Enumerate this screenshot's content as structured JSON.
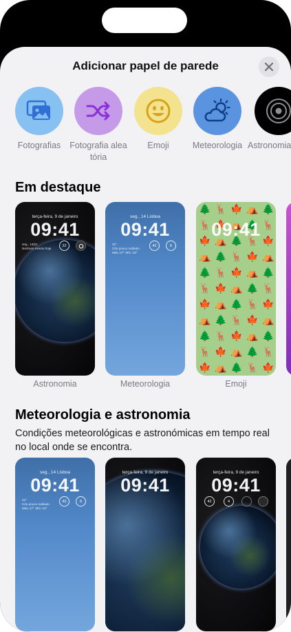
{
  "header": {
    "title": "Adicionar papel de parede"
  },
  "categories": [
    {
      "label": "Fotografias",
      "icon": "photos-icon",
      "color": "#87c1f2"
    },
    {
      "label": "Fotografia aleatória",
      "icon": "shuffle-icon",
      "color": "#c59be9"
    },
    {
      "label": "Emoji",
      "icon": "smiley-icon",
      "color": "#f3e38e"
    },
    {
      "label": "Meteorologia",
      "icon": "weather-icon",
      "color": "#5a93e0"
    },
    {
      "label": "Astronomia",
      "icon": "astronomy-icon",
      "color": "#000000"
    }
  ],
  "featured": {
    "title": "Em destaque",
    "cards": [
      {
        "label": "Astronomia",
        "date": "terça-feira, 9 de janeiro",
        "time": "09:41",
        "widget_line1": "seg., 14|21",
        "widget_line2": "Nenhum evento hoje",
        "ring": "22"
      },
      {
        "label": "Meteorologia",
        "date": "seg., 14  Lisboa",
        "time": "09:41",
        "widget_line1": "22°",
        "widget_line2": "Céu pouco nublado",
        "widget_line3": "Máx.:27° Mín.:18°",
        "ring1": "42",
        "ring2": "6"
      },
      {
        "label": "Emoji",
        "time": "09:41",
        "emojis": [
          "🌲",
          "🦌",
          "🍁",
          "⛺"
        ]
      }
    ]
  },
  "weather_astro": {
    "title": "Meteorologia e astronomia",
    "description": "Condições meteorológicas e astronómicas em tempo real no local onde se encontra.",
    "cards": [
      {
        "date": "seg., 14  Lisboa",
        "time": "09:41",
        "widget_line1": "22°",
        "widget_line2": "Céu pouco nublado",
        "widget_line3": "Máx.:27° Mín.:18°",
        "ring1": "42",
        "ring2": "6"
      },
      {
        "date": "terça-feira, 9 de janeiro",
        "time": "09:41"
      },
      {
        "date": "terça-feira, 9 de janeiro",
        "time": "09:41",
        "ring1": "42",
        "ring2": "4"
      }
    ]
  }
}
